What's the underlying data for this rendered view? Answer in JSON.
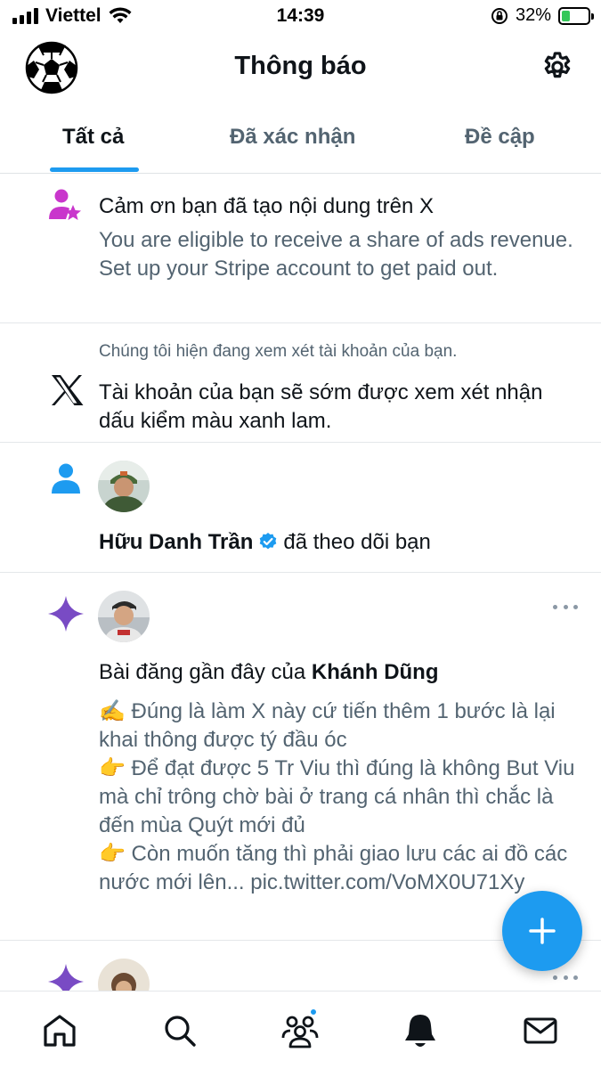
{
  "status_bar": {
    "carrier": "Viettel",
    "time": "14:39",
    "battery_percent": "32%",
    "battery_level": 0.32
  },
  "header": {
    "title": "Thông báo",
    "avatar_icon": "soccer-ball-icon",
    "settings_icon": "gear-icon"
  },
  "tabs": [
    {
      "label": "Tất cả",
      "active": true
    },
    {
      "label": "Đã xác nhận",
      "active": false
    },
    {
      "label": "Đề cập",
      "active": false
    }
  ],
  "notifications": {
    "revenue": {
      "icon": "creator-star-icon",
      "title": "Cảm ơn bạn đã tạo nội dung trên X",
      "body": "You are eligible to receive a share of ads revenue. Set up your Stripe account to get paid out."
    },
    "verification": {
      "icon": "x-logo-icon",
      "note": "Chúng tôi hiện đang xem xét tài khoản của bạn.",
      "body": "Tài khoản của bạn sẽ sớm được xem xét nhận dấu kiểm màu xanh lam."
    },
    "follow": {
      "icon": "person-icon",
      "user_name": "Hữu Danh Trần",
      "action": "đã theo dõi bạn"
    },
    "recent_post": {
      "icon": "sparkle-icon",
      "heading_prefix": "Bài đăng gần đây của",
      "author": "Khánh Dũng",
      "lines": [
        "✍️ Đúng là làm X này cứ tiến thêm 1 bước là lại khai thông được tý đầu óc",
        "👉 Để đạt được 5 Tr Viu thì đúng là không But Viu mà chỉ trông chờ bài ở trang cá nhân thì chắc là đến mùa Quýt mới đủ",
        "👉 Còn muốn tăng thì phải giao lưu các ai đồ các nước mới lên... pic.twitter.com/VoMX0U71Xy"
      ]
    }
  },
  "colors": {
    "accent": "#1d9bf0",
    "sparkle": "#794bc4",
    "creator": "#c936cc",
    "muted_text": "#536471"
  },
  "bottom_nav": [
    "home-icon",
    "search-icon",
    "communities-icon",
    "notifications-bell-icon",
    "messages-icon"
  ]
}
